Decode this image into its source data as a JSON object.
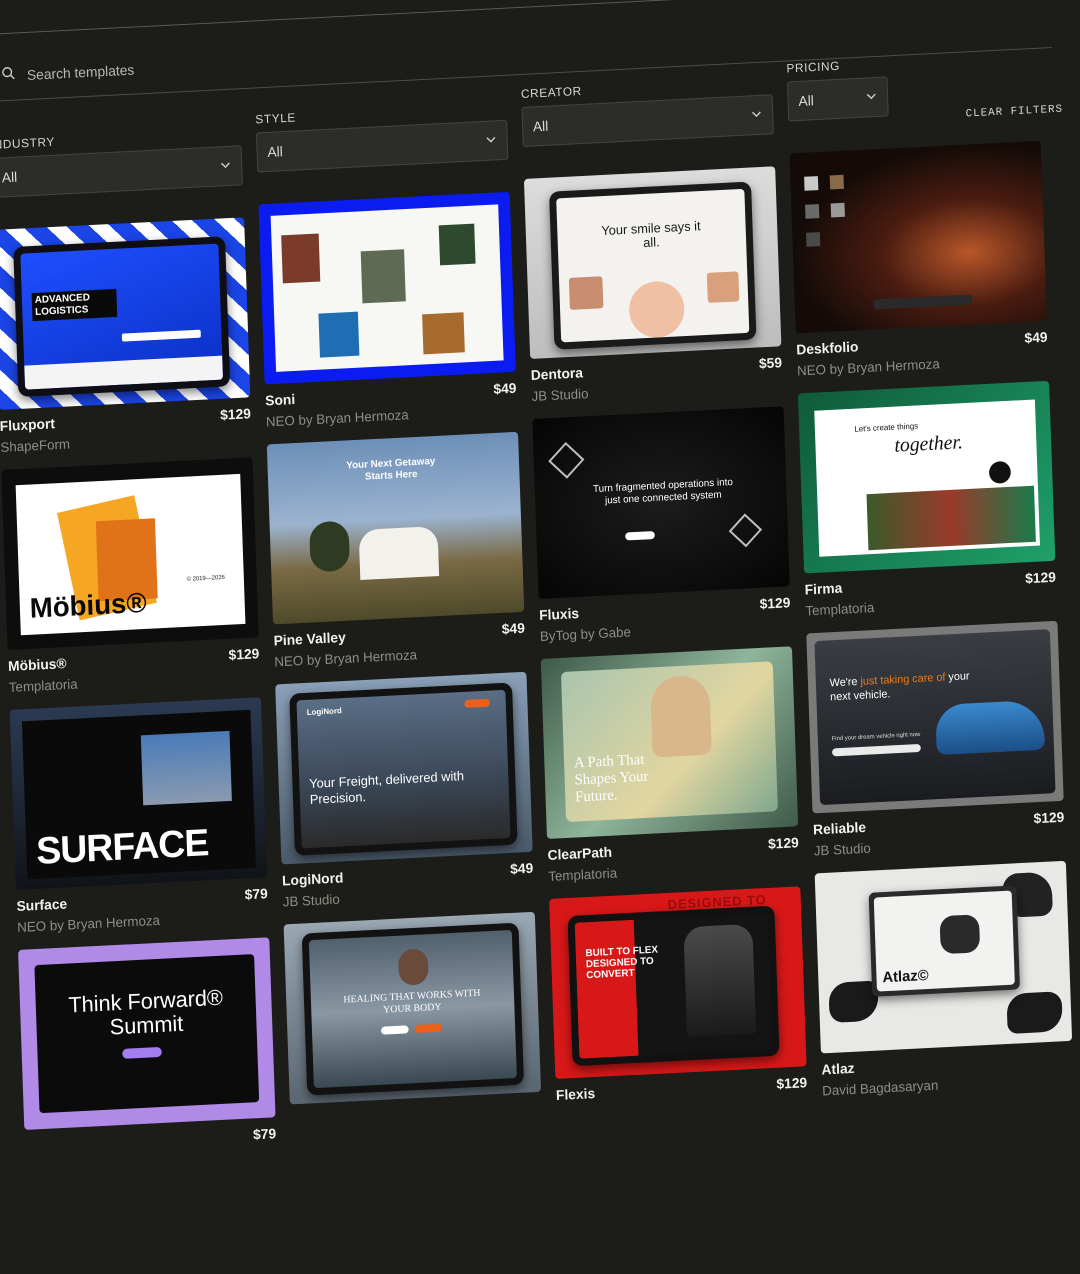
{
  "search": {
    "placeholder": "Search templates"
  },
  "filters": [
    {
      "label": "INDUSTRY",
      "value": "All"
    },
    {
      "label": "STYLE",
      "value": "All"
    },
    {
      "label": "CREATOR",
      "value": "All"
    },
    {
      "label": "PRICING",
      "value": "All"
    }
  ],
  "clear_filters": "CLEAR FILTERS",
  "cards": [
    {
      "name": "Fluxport",
      "creator": "ShapeForm",
      "price": "$129",
      "thumb": {
        "headline": "ADVANCED LOGISTICS"
      }
    },
    {
      "name": "Soni",
      "creator": "NEO by Bryan Hermoza",
      "price": "$49",
      "thumb": {}
    },
    {
      "name": "Dentora",
      "creator": "JB Studio",
      "price": "$59",
      "thumb": {
        "headline": "Your smile says it all."
      }
    },
    {
      "name": "Deskfolio",
      "creator": "NEO by Bryan Hermoza",
      "price": "$49",
      "thumb": {}
    },
    {
      "name": "Möbius®",
      "creator": "Templatoria",
      "price": "$129",
      "thumb": {
        "headline": "Möbius®",
        "tag": "© 2019—2026"
      }
    },
    {
      "name": "Pine Valley",
      "creator": "NEO by Bryan Hermoza",
      "price": "$49",
      "thumb": {
        "headline": "Your Next Getaway Starts Here"
      }
    },
    {
      "name": "Fluxis",
      "creator": "ByTog by Gabe",
      "price": "$129",
      "thumb": {
        "headline": "Turn fragmented operations into just one connected system"
      }
    },
    {
      "name": "Firma",
      "creator": "Templatoria",
      "price": "$129",
      "thumb": {
        "sub": "Let's create things",
        "headline": "together."
      }
    },
    {
      "name": "Surface",
      "creator": "NEO by Bryan Hermoza",
      "price": "$79",
      "thumb": {
        "headline": "SURFACE"
      }
    },
    {
      "name": "LogiNord",
      "creator": "JB Studio",
      "price": "$49",
      "thumb": {
        "brand": "LogiNord",
        "headline": "Your Freight, delivered with Precision."
      }
    },
    {
      "name": "ClearPath",
      "creator": "Templatoria",
      "price": "$129",
      "thumb": {
        "headline": "A Path That Shapes Your Future."
      }
    },
    {
      "name": "Reliable",
      "creator": "JB Studio",
      "price": "$129",
      "thumb": {
        "headline_a": "We're",
        "headline_b": "just taking care of",
        "headline_c": "your next vehicle.",
        "sub": "Find your dream vehicle right now"
      }
    },
    {
      "name": "",
      "creator": "",
      "price": "$79",
      "thumb": {
        "headline": "Think Forward® Summit"
      }
    },
    {
      "name": "",
      "creator": "",
      "price": "",
      "thumb": {
        "headline": "HEALING THAT WORKS WITH YOUR BODY"
      }
    },
    {
      "name": "Flexis",
      "creator": "",
      "price": "$129",
      "thumb": {
        "headline": "BUILT TO FLEX DESIGNED TO CONVERT",
        "bg_text": "DESIGNED TO"
      }
    },
    {
      "name": "Atlaz",
      "creator": "David Bagdasaryan",
      "price": "",
      "thumb": {
        "headline": "Atlaz©"
      }
    }
  ],
  "colors": {
    "background": "#1c1c19",
    "field": "#2c2c28",
    "muted": "#8e8e86"
  }
}
